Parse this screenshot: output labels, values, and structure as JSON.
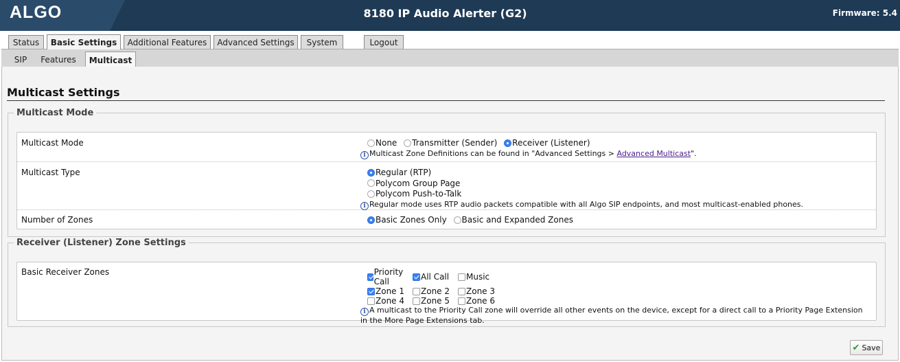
{
  "header": {
    "logo": "ALGO",
    "title": "8180 IP Audio Alerter (G2)",
    "firmware": "Firmware: 5.4"
  },
  "main_tabs": [
    "Status",
    "Basic Settings",
    "Additional Features",
    "Advanced Settings",
    "System",
    "Logout"
  ],
  "main_tabs_active": "Basic Settings",
  "sub_tabs": [
    "SIP",
    "Features",
    "Multicast"
  ],
  "sub_tabs_active": "Multicast",
  "page_title": "Multicast Settings",
  "multicast_mode_section": {
    "legend": "Multicast Mode",
    "mode": {
      "label": "Multicast Mode",
      "options": [
        "None",
        "Transmitter (Sender)",
        "Receiver (Listener)"
      ],
      "selected": "Receiver (Listener)",
      "info_prefix": "Multicast Zone Definitions can be found in \"Advanced Settings > ",
      "info_link": "Advanced Multicast",
      "info_suffix": "\"."
    },
    "type": {
      "label": "Multicast Type",
      "options": [
        "Regular (RTP)",
        "Polycom Group Page",
        "Polycom Push-to-Talk"
      ],
      "selected": "Regular (RTP)",
      "info": "Regular mode uses RTP audio packets compatible with all Algo SIP endpoints, and most multicast-enabled phones."
    },
    "zones": {
      "label": "Number of Zones",
      "options": [
        "Basic Zones Only",
        "Basic and Expanded Zones"
      ],
      "selected": "Basic Zones Only"
    }
  },
  "receiver_section": {
    "legend": "Receiver (Listener) Zone Settings",
    "label": "Basic Receiver Zones",
    "zones": [
      {
        "name": "Priority Call",
        "checked": true
      },
      {
        "name": "All Call",
        "checked": true
      },
      {
        "name": "Music",
        "checked": false
      },
      {
        "name": "Zone 1",
        "checked": true
      },
      {
        "name": "Zone 2",
        "checked": false
      },
      {
        "name": "Zone 3",
        "checked": false
      },
      {
        "name": "Zone 4",
        "checked": false
      },
      {
        "name": "Zone 5",
        "checked": false
      },
      {
        "name": "Zone 6",
        "checked": false
      }
    ],
    "info_line1": "A multicast to the Priority Call zone will override all other events on the device, except for a direct call to a Priority Page Extension",
    "info_line2": "in the More Page Extensions tab."
  },
  "save_label": "Save"
}
